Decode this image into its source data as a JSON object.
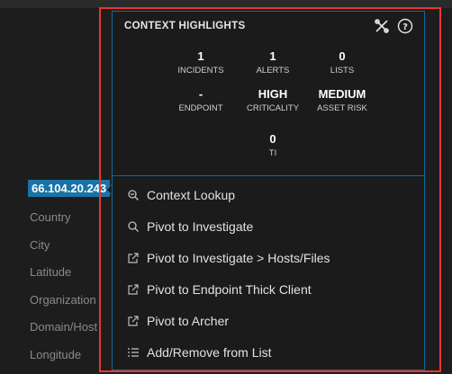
{
  "ip_address": "66.104.20.243",
  "fields": [
    "Country",
    "City",
    "Latitude",
    "Organization",
    "Domain/Host",
    "Longitude"
  ],
  "context": {
    "title": "CONTEXT HIGHLIGHTS",
    "icons": [
      "settings-tools-icon",
      "help-icon"
    ],
    "stats": [
      {
        "value": "1",
        "label": "INCIDENTS"
      },
      {
        "value": "1",
        "label": "ALERTS"
      },
      {
        "value": "0",
        "label": "LISTS"
      },
      {
        "value": "-",
        "label": "ENDPOINT"
      },
      {
        "value": "HIGH",
        "label": "CRITICALITY"
      },
      {
        "value": "MEDIUM",
        "label": "ASSET RISK"
      },
      {
        "value": "0",
        "label": "TI"
      }
    ]
  },
  "menu": [
    {
      "label": "Context Lookup",
      "icon": "context-lookup-icon"
    },
    {
      "label": "Pivot to Investigate",
      "icon": "search-icon"
    },
    {
      "label": "Pivot to Investigate > Hosts/Files",
      "icon": "external-link-icon"
    },
    {
      "label": "Pivot to Endpoint Thick Client",
      "icon": "external-link-icon"
    },
    {
      "label": "Pivot to Archer",
      "icon": "external-link-icon"
    },
    {
      "label": "Add/Remove from List",
      "icon": "list-icon"
    }
  ],
  "colors": {
    "highlight": "#e8362d",
    "accent": "#0f6a9e",
    "ip_bg": "#1a73a8"
  }
}
